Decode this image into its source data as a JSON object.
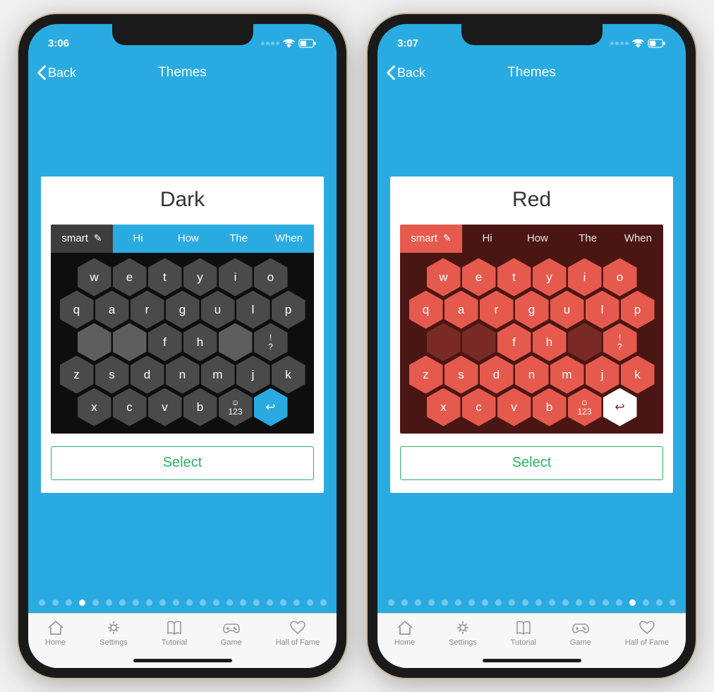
{
  "phones": [
    {
      "status_time": "3:06",
      "nav": {
        "back_label": "Back",
        "title": "Themes"
      },
      "theme": {
        "name": "Dark",
        "suggestions_left": "smart",
        "suggestions": [
          "Hi",
          "How",
          "The",
          "When"
        ],
        "rows": [
          [
            "w",
            "e",
            "t",
            "y",
            "i",
            "o"
          ],
          [
            "q",
            "a",
            "r",
            "g",
            "u",
            "l",
            "p"
          ],
          [
            "",
            "",
            "f",
            "h",
            "",
            "!\n?"
          ],
          [
            "z",
            "s",
            "d",
            "n",
            "m",
            "j",
            "k"
          ],
          [
            "x",
            "c",
            "v",
            "b",
            "☺\n123",
            "↩"
          ]
        ],
        "blank_indices": {
          "2": [
            0,
            1,
            4
          ]
        },
        "accent_indices": {
          "4": [
            5
          ]
        },
        "select_label": "Select"
      },
      "pager": {
        "count": 22,
        "active": 3
      },
      "tabs": [
        {
          "label": "Home"
        },
        {
          "label": "Settings"
        },
        {
          "label": "Tutorial"
        },
        {
          "label": "Game"
        },
        {
          "label": "Hall of Fame"
        }
      ]
    },
    {
      "status_time": "3:07",
      "nav": {
        "back_label": "Back",
        "title": "Themes"
      },
      "theme": {
        "name": "Red",
        "suggestions_left": "smart",
        "suggestions": [
          "Hi",
          "How",
          "The",
          "When"
        ],
        "rows": [
          [
            "w",
            "e",
            "t",
            "y",
            "i",
            "o"
          ],
          [
            "q",
            "a",
            "r",
            "g",
            "u",
            "l",
            "p"
          ],
          [
            "",
            "",
            "f",
            "h",
            "",
            "!\n?"
          ],
          [
            "z",
            "s",
            "d",
            "n",
            "m",
            "j",
            "k"
          ],
          [
            "x",
            "c",
            "v",
            "b",
            "☺\n123",
            "↩"
          ]
        ],
        "blank_indices": {
          "2": [
            0,
            1,
            4
          ]
        },
        "accent_indices": {
          "4": [
            5
          ]
        },
        "select_label": "Select"
      },
      "pager": {
        "count": 22,
        "active": 18
      },
      "tabs": [
        {
          "label": "Home"
        },
        {
          "label": "Settings"
        },
        {
          "label": "Tutorial"
        },
        {
          "label": "Game"
        },
        {
          "label": "Hall of Fame"
        }
      ]
    }
  ],
  "colors": {
    "app_bg": "#29abe2",
    "select_green": "#28b463",
    "dark_key": "#4a4a4a",
    "red_key": "#e65a4e"
  }
}
